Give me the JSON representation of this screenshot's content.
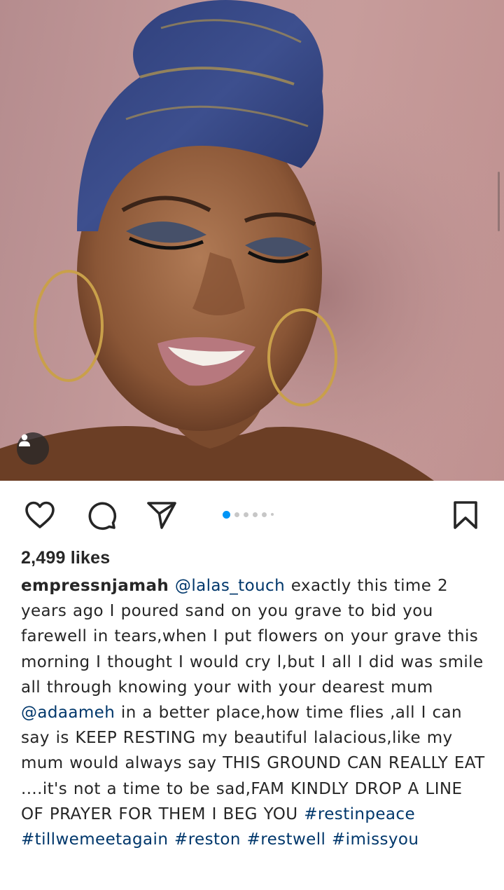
{
  "post": {
    "likes_text": "2,499 likes",
    "username": "empressnjamah",
    "mention_1": "@lalas_touch",
    "caption_part_1": " exactly this time 2 years ago I poured sand on you grave to bid you farewell in tears,when I put flowers on your grave this morning I thought I would cry l,but I all I did was smile all through knowing your with your dearest mum ",
    "mention_2": "@adaameh",
    "caption_part_2": " in a better place,how time flies ,all I can say is KEEP RESTING my beautiful lalacious,like my mum would always say THIS GROUND CAN REALLY EAT ....it's not a time to be sad,FAM KINDLY DROP A LINE OF PRAYER FOR THEM I BEG YOU ",
    "hashtags": [
      "#restinpeace",
      "#tillwemeetagain",
      "#reston",
      "#restwell",
      "#imissyou"
    ]
  },
  "carousel": {
    "total_slides": 6,
    "active_index": 0
  },
  "icons": {
    "like": "heart-icon",
    "comment": "comment-bubble-icon",
    "share": "paper-plane-icon",
    "save": "bookmark-icon",
    "user_tags": "person-icon"
  },
  "colors": {
    "active_dot": "#0095f6",
    "inactive_dot": "#c7c7c7",
    "link": "#00376b",
    "text": "#262626"
  }
}
